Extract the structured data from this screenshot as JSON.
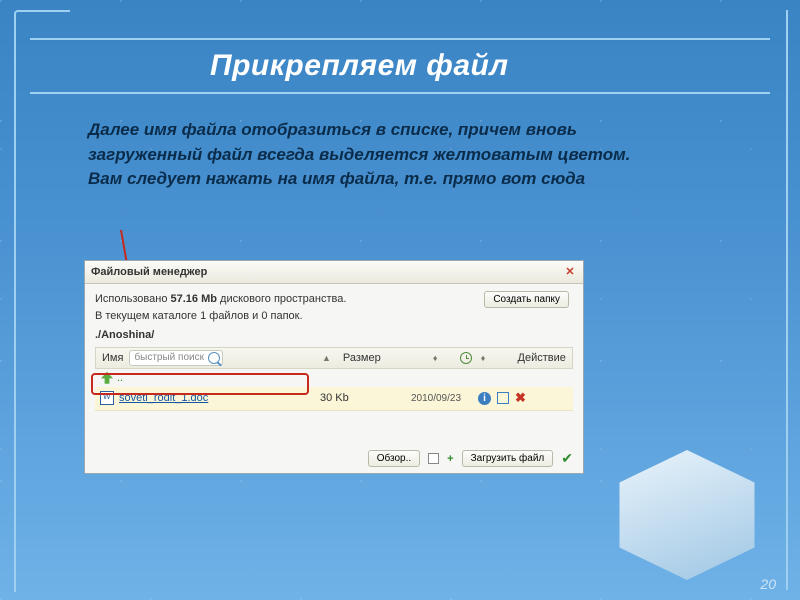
{
  "slide": {
    "title": "Прикрепляем файл",
    "description": "Далее имя файла отобразиться в списке, причем вновь загруженный файл всегда выделяется желтоватым цветом. Вам следует нажать на имя файла, т.е. прямо вот сюда",
    "number": "20"
  },
  "fm": {
    "window_title": "Файловый менеджер",
    "usage_line1_prefix": "Использовано ",
    "usage_size": "57.16 Mb",
    "usage_line1_suffix": " дискового пространства.",
    "usage_line2": "В текущем каталоге 1 файлов и 0 папок.",
    "create_folder": "Создать папку",
    "path": "./Anoshina/",
    "columns": {
      "name": "Имя",
      "search_placeholder": "быстрый поиск",
      "size": "Размер",
      "action": "Действие"
    },
    "file": {
      "name": "soveti_rodit_1.doc",
      "size": "30 Kb",
      "date": "2010/09/23"
    },
    "footer": {
      "browse": "Обзор..",
      "upload": "Загрузить файл"
    }
  }
}
